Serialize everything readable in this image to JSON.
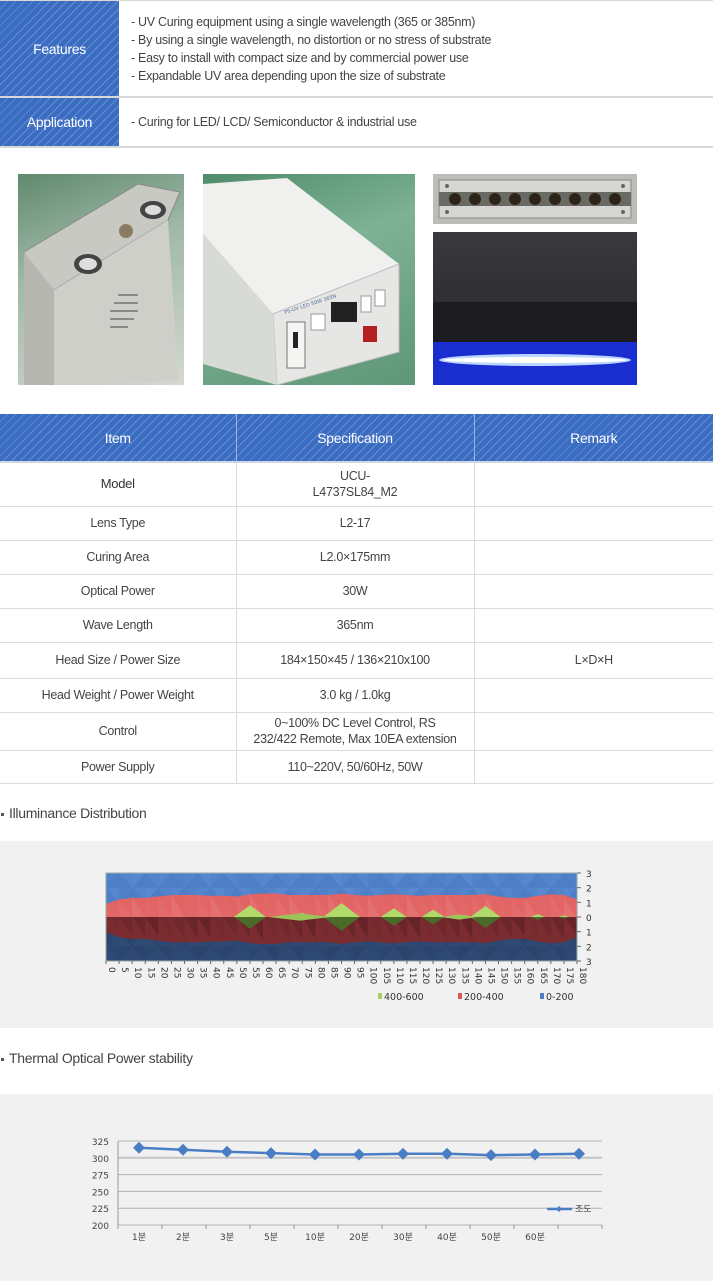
{
  "features": {
    "label": "Features",
    "items": [
      "- UV Curing equipment using a single wavelength (365 or 385nm)",
      "- By using a single wavelength, no distortion or no stress of substrate",
      "- Easy to install with compact size and by commercial power use",
      "- Expandable UV area depending upon the size of substrate"
    ]
  },
  "application": {
    "label": "Application",
    "text": "-  Curing for LED/ LCD/ Semiconductor & industrial use"
  },
  "photos": [
    {
      "name": "uv-head-unit-photo",
      "alt": "UV LED head unit"
    },
    {
      "name": "power-controller-photo",
      "alt": "Power supply controller"
    },
    {
      "name": "led-array-photo",
      "alt": "LED array front view"
    },
    {
      "name": "uv-light-emission-photo",
      "alt": "UV light emission"
    }
  ],
  "spec_table": {
    "headers": [
      "Item",
      "Specification",
      "Remark"
    ],
    "rows": [
      {
        "item": "Model",
        "spec": [
          "UCU-",
          "L4737SL84_M2"
        ],
        "remark": ""
      },
      {
        "item": "Lens Type",
        "spec": [
          "L2-17"
        ],
        "remark": ""
      },
      {
        "item": "Curing Area",
        "spec": [
          "L2.0×175mm"
        ],
        "remark": ""
      },
      {
        "item": "Optical Power",
        "spec": [
          "30W"
        ],
        "remark": ""
      },
      {
        "item": "Wave Length",
        "spec": [
          "365nm"
        ],
        "remark": ""
      },
      {
        "item": "Head Size / Power Size",
        "spec": [
          "184×150×45 / 136×210x100"
        ],
        "remark": "L×D×H"
      },
      {
        "item": "Head Weight / Power Weight",
        "spec": [
          "3.0 kg / 1.0kg"
        ],
        "remark": ""
      },
      {
        "item": "Control",
        "spec": [
          "0~100% DC Level Control, RS",
          "232/422 Remote, Max 10EA extension"
        ],
        "remark": ""
      },
      {
        "item": "Power Supply",
        "spec": [
          "110~220V, 50/60Hz, 50W"
        ],
        "remark": ""
      }
    ]
  },
  "illuminance_title": "Illuminance Distribution",
  "thermal_title": "Thermal Optical Power stability",
  "colors": {
    "header_blue": "#3a6cc2",
    "band_low": "#4f7fc4",
    "band_mid": "#d85858",
    "band_high": "#a8d060",
    "line": "#4a7ec4"
  },
  "chart_data": [
    {
      "type": "heatmap",
      "title": "Illuminance Distribution",
      "x": [
        0,
        5,
        10,
        15,
        20,
        25,
        30,
        35,
        40,
        45,
        50,
        55,
        60,
        65,
        70,
        75,
        80,
        85,
        90,
        95,
        100,
        105,
        110,
        115,
        120,
        125,
        130,
        135,
        140,
        145,
        150,
        155,
        160,
        165,
        170,
        175,
        180
      ],
      "y_ticks": [
        "3",
        "2",
        "1",
        "0",
        "1",
        "2",
        "3"
      ],
      "y_values": [
        3,
        2,
        1,
        0,
        -1,
        -2,
        -3
      ],
      "band_half_width_200": [
        0.9,
        1.2,
        1.3,
        1.3,
        1.4,
        1.5,
        1.5,
        1.5,
        1.45,
        1.45,
        1.4,
        1.55,
        1.6,
        1.6,
        1.5,
        1.5,
        1.5,
        1.5,
        1.6,
        1.5,
        1.45,
        1.5,
        1.55,
        1.5,
        1.45,
        1.5,
        1.5,
        1.5,
        1.5,
        1.55,
        1.4,
        1.3,
        1.3,
        1.45,
        1.55,
        1.5,
        1.2
      ],
      "peaks_400": [
        {
          "x": 55,
          "half_width": 0.8
        },
        {
          "x": 75,
          "half_width": 0.3
        },
        {
          "x": 90,
          "half_width": 0.95
        },
        {
          "x": 110,
          "half_width": 0.6
        },
        {
          "x": 125,
          "half_width": 0.5
        },
        {
          "x": 145,
          "half_width": 0.75
        },
        {
          "x": 165,
          "half_width": 0.2
        },
        {
          "x": 175,
          "half_width": 0.1
        }
      ],
      "legend": [
        {
          "label": "400-600",
          "color": "#a8d060"
        },
        {
          "label": "200-400",
          "color": "#d85858"
        },
        {
          "label": "0-200",
          "color": "#4f7fc4"
        }
      ],
      "legend_position": "bottom-right",
      "xlim": [
        0,
        180
      ],
      "ylim": [
        -3,
        3
      ]
    },
    {
      "type": "line",
      "title": "Thermal Optical Power stability",
      "categories": [
        "1분",
        "2분",
        "3분",
        "5분",
        "10분",
        "20분",
        "30분",
        "40분",
        "50분",
        "60분",
        ""
      ],
      "series": [
        {
          "name": "조도",
          "values": [
            315,
            312,
            309,
            307,
            305,
            305,
            306,
            306,
            304,
            305,
            306
          ]
        }
      ],
      "y_ticks": [
        200,
        225,
        250,
        275,
        300,
        325
      ],
      "ylim": [
        200,
        325
      ],
      "grid": true,
      "legend_position": "right"
    }
  ]
}
